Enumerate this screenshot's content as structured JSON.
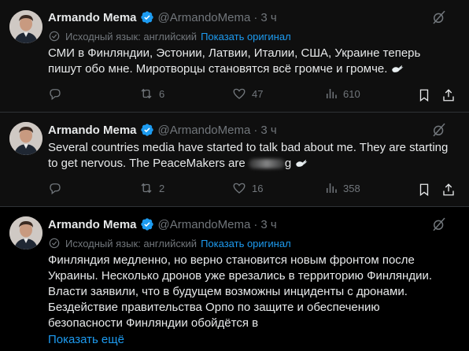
{
  "icons": [
    "verified-badge-icon",
    "grok-icon",
    "translate-icon",
    "reply-icon",
    "retweet-icon",
    "like-icon",
    "views-icon",
    "bookmark-icon",
    "share-icon",
    "dove-icon"
  ],
  "colors": {
    "background": "#000000",
    "card": "#0f0f0f",
    "text": "#e7e9ea",
    "secondary": "#71767b",
    "accent": "#1d9bf0",
    "border": "#2f3336"
  },
  "tweets": [
    {
      "name": "Armando Mema",
      "handle": "@ArmandoMema",
      "dot": "·",
      "time": "3 ч",
      "translated_label": "Исходный язык: английский",
      "show_original": "Показать оригинал",
      "text": "СМИ в Финляндии, Эстонии, Латвии, Италии, США, Украине теперь пишут обо мне. Миротворцы становятся всё громче и громче.",
      "replies": "",
      "retweets": "6",
      "likes": "47",
      "views": "610"
    },
    {
      "name": "Armando Mema",
      "handle": "@ArmandoMema",
      "dot": "·",
      "time": "3 ч",
      "text_before": "Several countries media have started to talk bad about me. They are starting to get nervous. The PeaceMakers are ",
      "text_after": "g",
      "replies": "",
      "retweets": "2",
      "likes": "16",
      "views": "358"
    },
    {
      "name": "Armando Mema",
      "handle": "@ArmandoMema",
      "dot": "·",
      "time": "3 ч",
      "translated_label": "Исходный язык: английский",
      "show_original": "Показать оригинал",
      "text": "Финляндия медленно, но верно становится новым фронтом после Украины. Несколько дронов уже врезались в территорию Финляндии. Власти заявили, что в будущем возможны инциденты с дронами. Бездействие правительства Орпо по защите и обеспечению безопасности Финляндии обойдётся в",
      "show_more": "Показать ещё"
    }
  ]
}
